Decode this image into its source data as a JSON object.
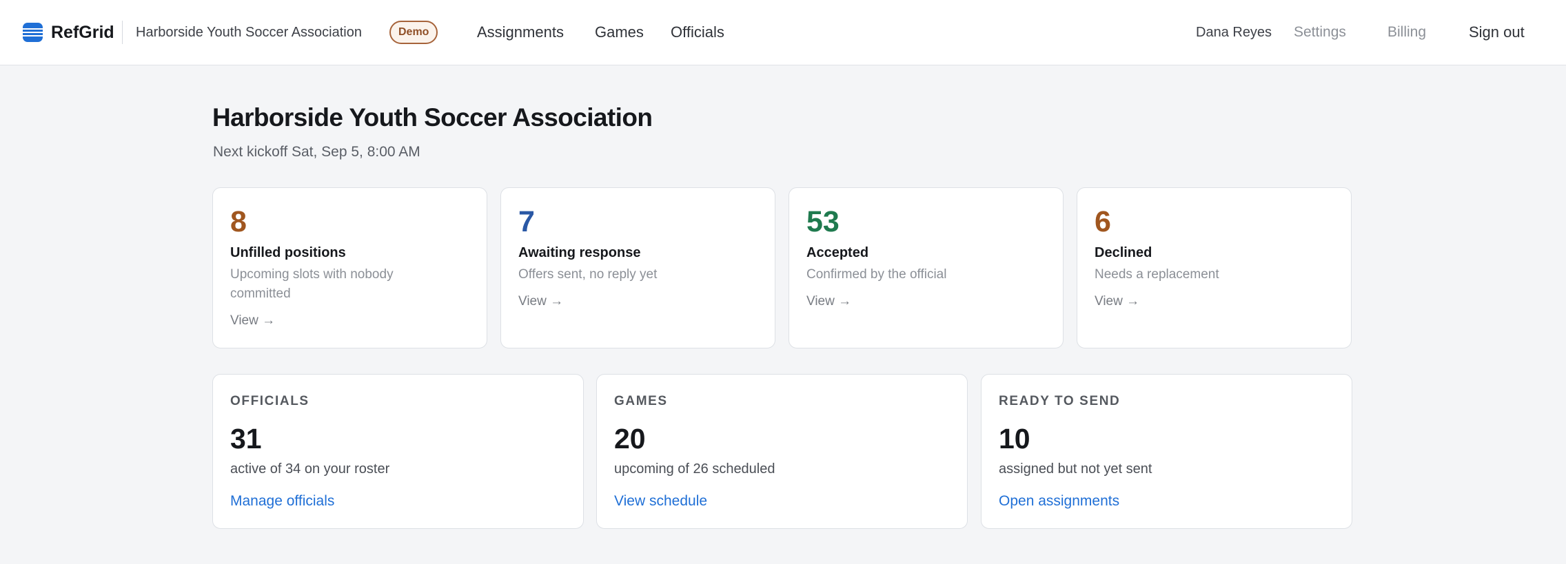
{
  "brand": {
    "name": "RefGrid",
    "org": "Harborside Youth Soccer Association",
    "badge": "Demo",
    "accent": "#1f6fd6"
  },
  "nav": {
    "assignments": "Assignments",
    "games": "Games",
    "officials": "Officials"
  },
  "user": {
    "name": "Dana Reyes",
    "settings": "Settings",
    "billing": "Billing",
    "sign_out": "Sign out"
  },
  "page": {
    "title": "Harborside Youth Soccer Association",
    "subtitle": "Next kickoff Sat, Sep 5, 8:00 AM"
  },
  "stats": [
    {
      "value": "8",
      "label": "Unfilled positions",
      "desc": "Upcoming slots with nobody committed",
      "link": "View →",
      "color": "#a0561f"
    },
    {
      "value": "7",
      "label": "Awaiting response",
      "desc": "Offers sent, no reply yet",
      "link": "View →",
      "color": "#2a58a5"
    },
    {
      "value": "53",
      "label": "Accepted",
      "desc": "Confirmed by the official",
      "link": "View →",
      "color": "#1f7a4e"
    },
    {
      "value": "6",
      "label": "Declined",
      "desc": "Needs a replacement",
      "link": "View →",
      "color": "#a0561f"
    }
  ],
  "summary": [
    {
      "heading": "OFFICIALS",
      "value": "31",
      "desc": "active of 34 on your roster",
      "link": "Manage officials"
    },
    {
      "heading": "GAMES",
      "value": "20",
      "desc": "upcoming of 26 scheduled",
      "link": "View schedule"
    },
    {
      "heading": "READY TO SEND",
      "value": "10",
      "desc": "assigned but not yet sent",
      "link": "Open assignments"
    }
  ]
}
